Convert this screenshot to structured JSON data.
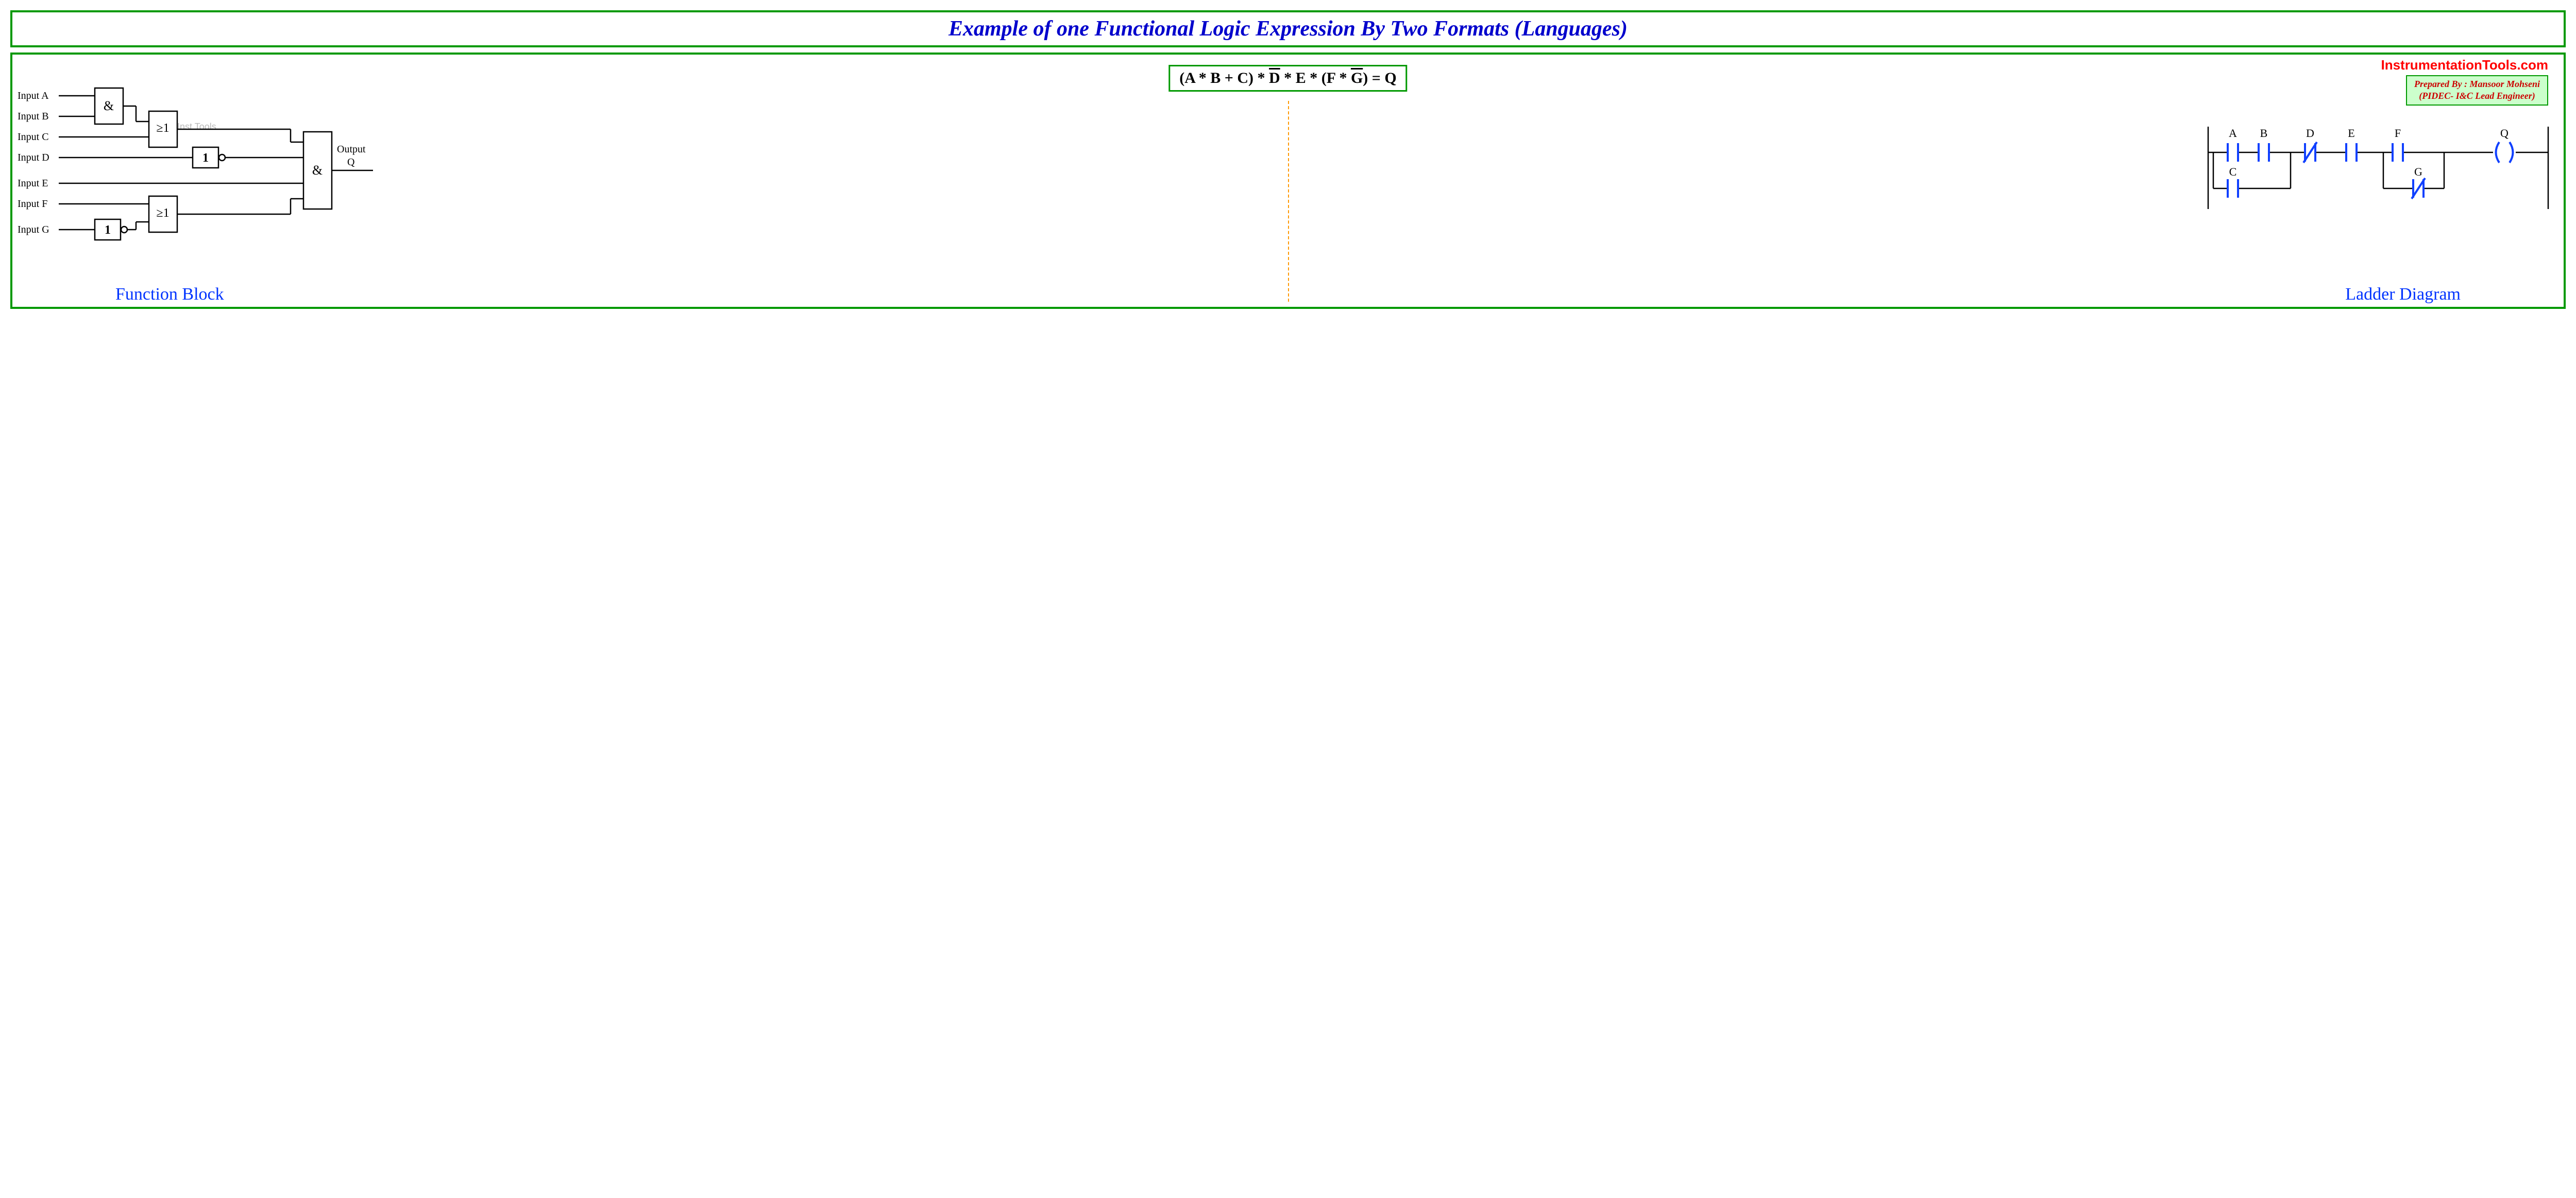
{
  "title": "Example of one Functional Logic Expression By Two Formats (Languages)",
  "expression": {
    "prefix": "(A * B + C) * ",
    "dbar": "D",
    "mid": " * E * (F * ",
    "gbar": "G",
    "suffix": ") = Q"
  },
  "site": "InstrumentationTools.com",
  "credit_line1": "Prepared By : Mansoor Mohseni",
  "credit_line2": "(PIDEC- I&C Lead Engineer)",
  "watermark": "Inst Tools",
  "caption_left": "Function Block",
  "caption_right": "Ladder Diagram",
  "fb": {
    "inputs": [
      "Input A",
      "Input B",
      "Input C",
      "Input D",
      "Input E",
      "Input F",
      "Input G"
    ],
    "gate_and1": "&",
    "gate_or1": "≥1",
    "gate_not1": "1",
    "gate_or2": "≥1",
    "gate_not2": "1",
    "gate_and_final": "&",
    "output_line1": "Output",
    "output_line2": "Q"
  },
  "ladder": {
    "contacts": [
      "A",
      "B",
      "C",
      "D",
      "E",
      "F",
      "G"
    ],
    "coil": "Q"
  }
}
